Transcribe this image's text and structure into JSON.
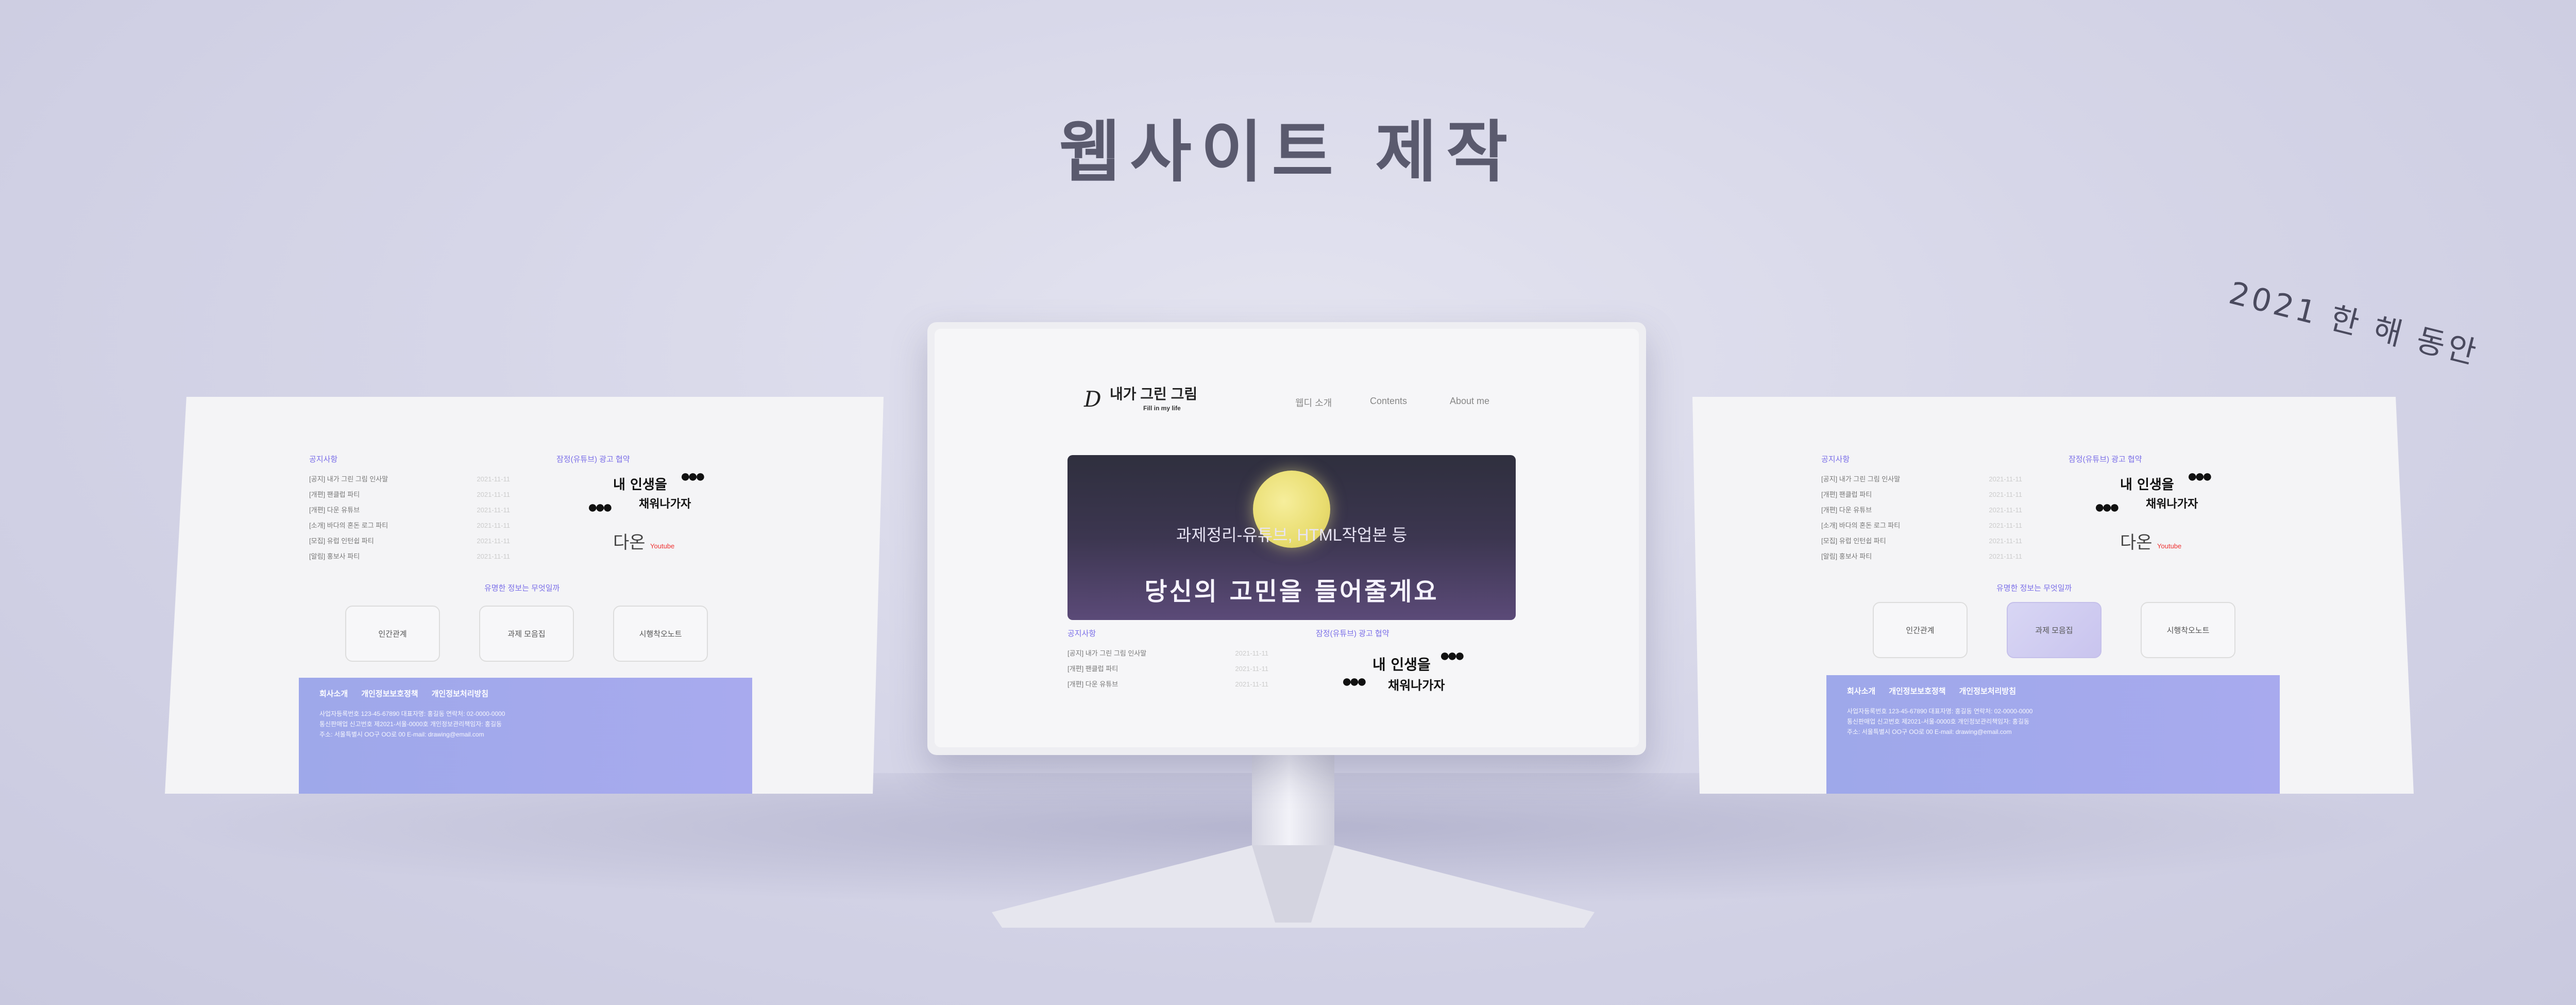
{
  "heading": {
    "title": "웹사이트 제작",
    "subtitle": "2021 한 해 동안"
  },
  "site": {
    "brand_mark": "D",
    "brand_title": "내가 그린 그림",
    "brand_sub": "Fill in my life",
    "nav": [
      "웹디 소개",
      "Contents",
      "About me"
    ],
    "banner_line1": "과제정리-유튜브, HTML작업본 등",
    "banner_line2": "당신의 고민을 들어줄게요"
  },
  "sections": {
    "notice": "공지사항",
    "ad": "잠정(유튜브) 광고 협약",
    "news": "유명한 정보는 무엇일까",
    "notice_items": [
      {
        "title": "[공지] 내가 그린 그림 인사말",
        "date": "2021-11-11"
      },
      {
        "title": "[개편] 팬클럽 파티",
        "date": "2021-11-11"
      },
      {
        "title": "[개편] 다운 유튜브",
        "date": "2021-11-11"
      },
      {
        "title": "[소개] 바다의 혼돈 로그 파티",
        "date": "2021-11-11"
      },
      {
        "title": "[모집] 유럽 인턴쉽 파티",
        "date": "2021-11-11"
      },
      {
        "title": "[알림] 홍보사 파티",
        "date": "2021-11-11"
      }
    ],
    "calligraphy": [
      "내 인생을",
      "채워나가자"
    ],
    "dots": "●●●",
    "daon_logo": "다온",
    "youtube": "Youtube",
    "buttons": [
      "인간관계",
      "과제 모음집",
      "시행착오노트"
    ],
    "footer_links": [
      "회사소개",
      "개인정보보호정책",
      "개인정보처리방침"
    ],
    "footer_info": [
      "사업자등록번호 123-45-67890 대표자명: 홍길동 연락처: 02-0000-0000",
      "통신판매업 신고번호 제2021-서울-0000호 개인정보관리책임자: 홍길동",
      "주소: 서울특별시 OO구 OO로 00 E-mail: drawing@email.com"
    ]
  },
  "colors": {
    "accent": "#7a6ee8",
    "footer": "#9ea8ea",
    "banner_dark": "#2f2f3e"
  }
}
